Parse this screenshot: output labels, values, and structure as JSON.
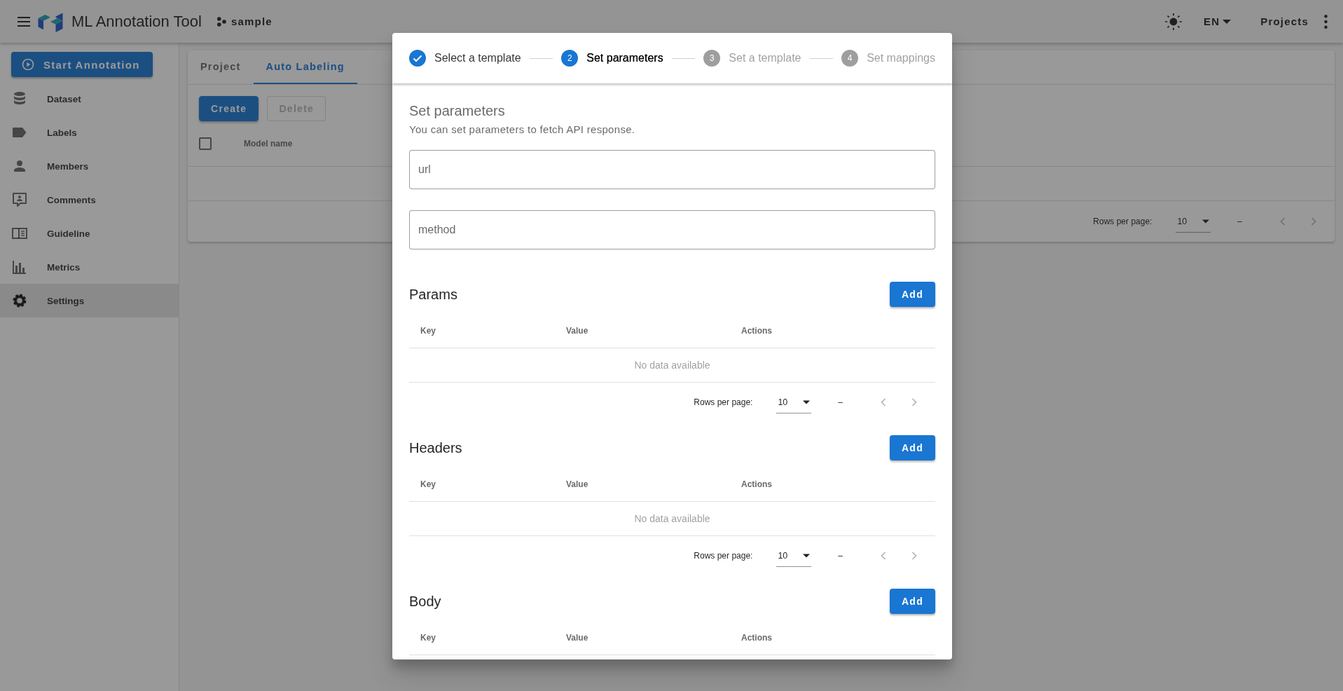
{
  "app_bar": {
    "title": "ML Annotation Tool",
    "project": "sample",
    "language": "EN",
    "projects_link": "Projects"
  },
  "sidebar": {
    "start_button": "Start Annotation",
    "items": [
      {
        "label": "Dataset",
        "selected": false
      },
      {
        "label": "Labels",
        "selected": false
      },
      {
        "label": "Members",
        "selected": false
      },
      {
        "label": "Comments",
        "selected": false
      },
      {
        "label": "Guideline",
        "selected": false
      },
      {
        "label": "Metrics",
        "selected": false
      },
      {
        "label": "Settings",
        "selected": true
      }
    ]
  },
  "settings": {
    "tabs": [
      {
        "label": "Project",
        "selected": false
      },
      {
        "label": "Auto Labeling",
        "selected": true
      }
    ],
    "buttons": [
      {
        "label": "Create",
        "disabled": false
      },
      {
        "label": "Delete",
        "disabled": true
      }
    ],
    "table": {
      "select_all_checked": false,
      "columns": [
        "Model name"
      ]
    },
    "footer": {
      "rows_per_page_label": "Rows per page:",
      "rows_per_page": "10",
      "range": "–"
    }
  },
  "dialog": {
    "steps": [
      {
        "label": "Select a template",
        "completed": true,
        "selected": false
      },
      {
        "number": "2",
        "label": "Set parameters",
        "completed": false,
        "selected": true
      },
      {
        "number": "3",
        "label": "Set a template",
        "completed": false,
        "selected": false
      },
      {
        "number": "4",
        "label": "Set mappings",
        "completed": false,
        "selected": false
      }
    ],
    "heading": "Set parameters",
    "description": "You can set parameters to fetch API response.",
    "fields": [
      {
        "placeholder": "url"
      },
      {
        "placeholder": "method"
      }
    ],
    "sections": [
      {
        "title": "Params",
        "add_button": "Add",
        "columns": [
          "Key",
          "Value",
          "Actions"
        ],
        "empty_text": "No data available",
        "footer": {
          "rows_per_page_label": "Rows per page:",
          "rows_per_page": "10",
          "range": "–"
        }
      },
      {
        "title": "Headers",
        "add_button": "Add",
        "columns": [
          "Key",
          "Value",
          "Actions"
        ],
        "empty_text": "No data available",
        "footer": {
          "rows_per_page_label": "Rows per page:",
          "rows_per_page": "10",
          "range": "–"
        }
      },
      {
        "title": "Body",
        "add_button": "Add",
        "columns": [
          "Key",
          "Value",
          "Actions"
        ]
      }
    ]
  }
}
